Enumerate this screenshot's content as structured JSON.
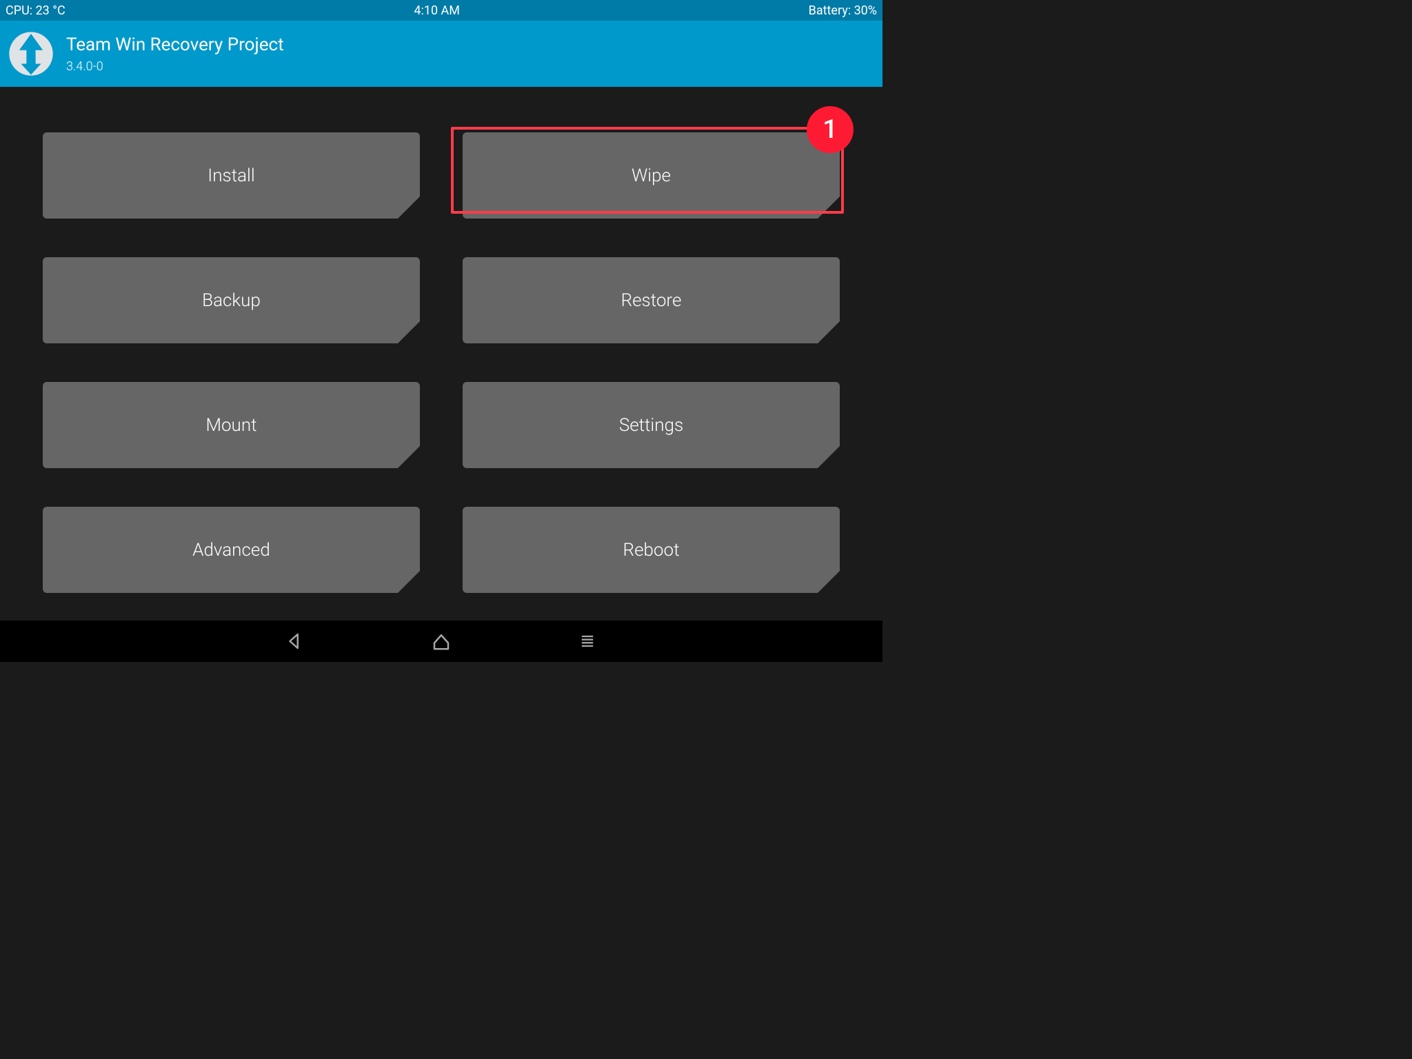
{
  "statusbar": {
    "cpu": "CPU: 23 °C",
    "time": "4:10 AM",
    "battery": "Battery: 30%"
  },
  "header": {
    "title": "Team Win Recovery Project",
    "version": "3.4.0-0"
  },
  "menu": [
    {
      "id": "install",
      "label": "Install"
    },
    {
      "id": "wipe",
      "label": "Wipe"
    },
    {
      "id": "backup",
      "label": "Backup"
    },
    {
      "id": "restore",
      "label": "Restore"
    },
    {
      "id": "mount",
      "label": "Mount"
    },
    {
      "id": "settings",
      "label": "Settings"
    },
    {
      "id": "advanced",
      "label": "Advanced"
    },
    {
      "id": "reboot",
      "label": "Reboot"
    }
  ],
  "annotation": {
    "number": "1",
    "target": "wipe"
  },
  "colors": {
    "statusbar_bg": "#007aa6",
    "header_bg": "#0099cc",
    "tile_bg": "#666666",
    "page_bg": "#1b1b1b",
    "highlight": "#ff3b4a",
    "badge": "#ff1a33"
  }
}
